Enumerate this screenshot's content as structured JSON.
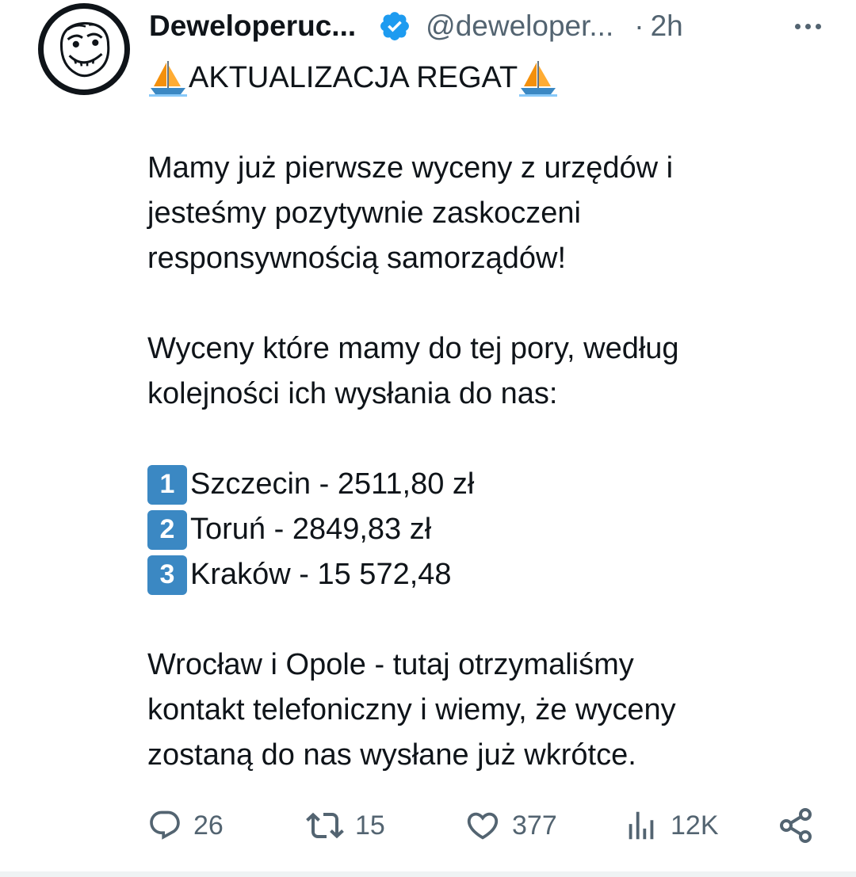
{
  "tweet": {
    "author": {
      "display_name": "Deweloperuc...",
      "handle": "@deweloper...",
      "verified_icon": "verified-badge-icon",
      "avatar": "troll-face-avatar"
    },
    "separator": "·",
    "time": "2h",
    "more_icon": "ellipsis-icon",
    "title_text": "AKTUALIZACJA REGAT",
    "title_emoji": "sailboat-icon",
    "paragraph1": [
      "Mamy już pierwsze wyceny z urzędów i",
      "jesteśmy pozytywnie zaskoczeni",
      "responsywnością samorządów!"
    ],
    "paragraph2": [
      "Wyceny które mamy do tej pory, według",
      "kolejności ich wysłania do nas:"
    ],
    "list": [
      {
        "number": "1",
        "text": "Szczecin - 2511,80 zł"
      },
      {
        "number": "2",
        "text": "Toruń - 2849,83 zł"
      },
      {
        "number": "3",
        "text": "Kraków - 15 572,48"
      }
    ],
    "paragraph3": [
      "Wrocław i Opole - tutaj otrzymaliśmy",
      "kontakt telefoniczny i wiemy, że wyceny",
      "zostaną do nas wysłane już wkrótce."
    ]
  },
  "actions": {
    "replies": {
      "icon": "reply-icon",
      "count": "26"
    },
    "retweets": {
      "icon": "retweet-icon",
      "count": "15"
    },
    "likes": {
      "icon": "heart-icon",
      "count": "377"
    },
    "views": {
      "icon": "views-icon",
      "count": "12K"
    },
    "share": {
      "icon": "share-icon"
    }
  },
  "colors": {
    "text": "#0f1419",
    "secondary": "#536471",
    "verified": "#1d9bf0",
    "keycap": "#3b88c3",
    "divider": "#eff3f4"
  }
}
